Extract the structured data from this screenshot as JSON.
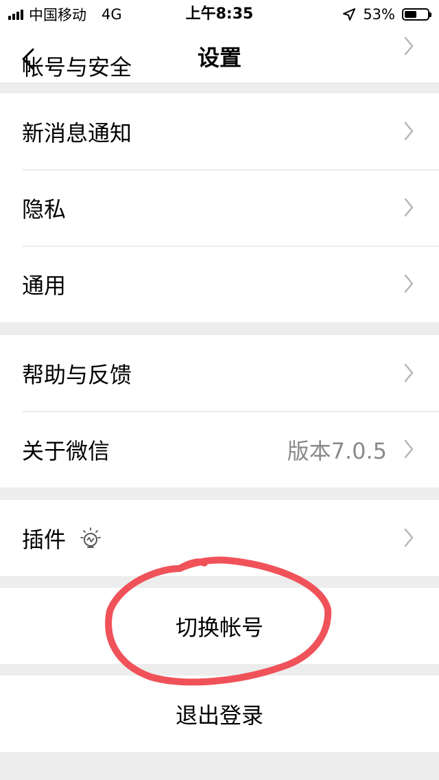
{
  "status_bar": {
    "carrier": "中国移动",
    "network": "4G",
    "time": "上午8:35",
    "battery": "53%",
    "battery_level": 0.53
  },
  "nav": {
    "title": "设置"
  },
  "rows": {
    "account_security": "帐号与安全",
    "notifications": "新消息通知",
    "privacy": "隐私",
    "general": "通用",
    "help_feedback": "帮助与反馈",
    "about": "关于微信",
    "version": "版本7.0.5",
    "plugins": "插件"
  },
  "actions": {
    "switch_account": "切换帐号",
    "logout": "退出登录"
  },
  "annotation_color": "#f0525a",
  "icons": [
    "signal-icon",
    "location-arrow-icon",
    "battery-icon",
    "back-icon",
    "chevron-right-icon",
    "bulb-icon"
  ]
}
